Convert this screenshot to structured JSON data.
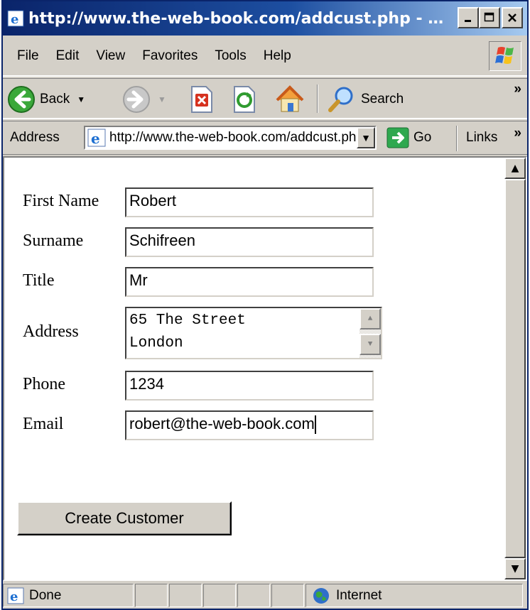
{
  "window": {
    "title": "http://www.the-web-book.com/addcust.php - Mic..."
  },
  "menu": [
    "File",
    "Edit",
    "View",
    "Favorites",
    "Tools",
    "Help"
  ],
  "toolbar": {
    "back_label": "Back",
    "search_label": "Search",
    "overflow": "»"
  },
  "addressbar": {
    "label": "Address",
    "url": "http://www.the-web-book.com/addcust.php",
    "go_label": "Go",
    "links_label": "Links",
    "overflow": "»"
  },
  "form": {
    "first_name": {
      "label": "First Name",
      "value": "Robert"
    },
    "surname": {
      "label": "Surname",
      "value": "Schifreen"
    },
    "title": {
      "label": "Title",
      "value": "Mr"
    },
    "address": {
      "label": "Address",
      "line1": "65 The Street",
      "line2": "London"
    },
    "phone": {
      "label": "Phone",
      "value": "1234"
    },
    "email": {
      "label": "Email",
      "value": "robert@the-web-book.com"
    },
    "submit_label": "Create Customer"
  },
  "status": {
    "text": "Done",
    "zone": "Internet"
  },
  "colors": {
    "titlebar": "#0a246a",
    "chrome": "#d4d0c8",
    "go_arrow": "#2fa84f"
  }
}
